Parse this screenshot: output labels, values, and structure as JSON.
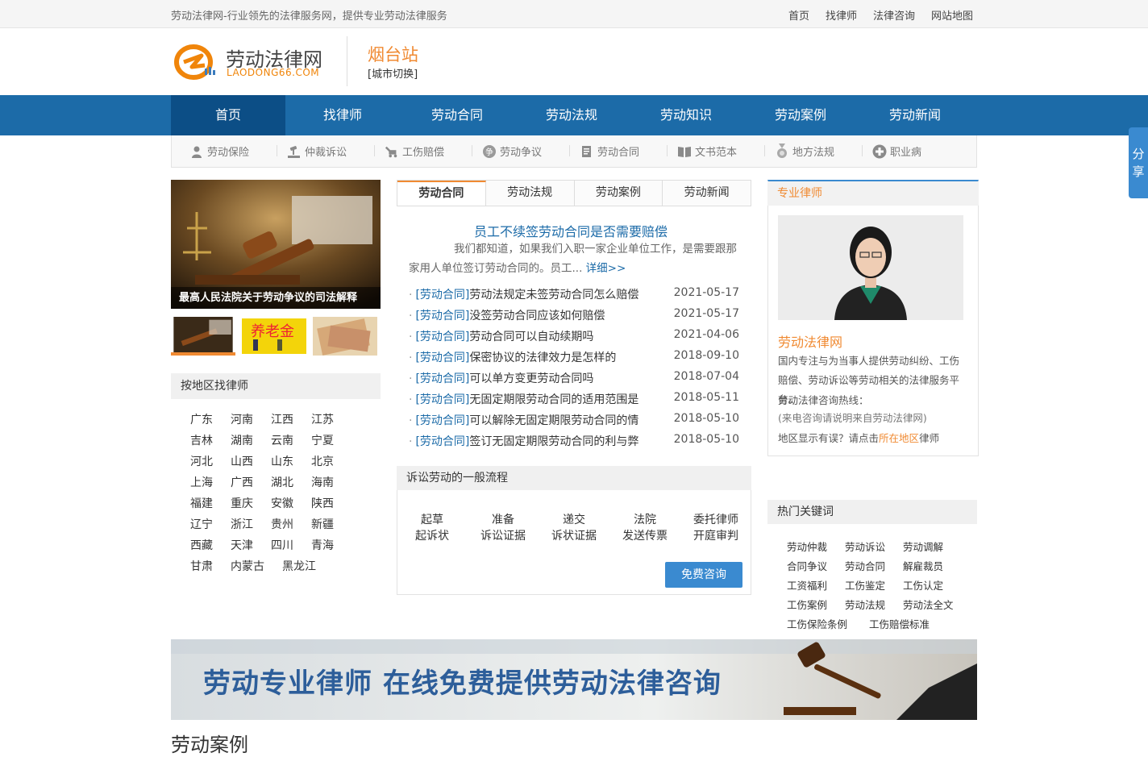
{
  "topbar": {
    "slogan": "劳动法律网-行业领先的法律服务网，提供专业劳动法律服务",
    "links": [
      "首页",
      "找律师",
      "法律咨询",
      "网站地图"
    ]
  },
  "header": {
    "logo_cn": "劳动法律网",
    "logo_en": "LAODONG66.COM",
    "city": "烟台站",
    "city_switch": "[城市切换]"
  },
  "nav": {
    "items": [
      "首页",
      "找律师",
      "劳动合同",
      "劳动法规",
      "劳动知识",
      "劳动案例",
      "劳动新闻"
    ]
  },
  "subnav": {
    "items": [
      {
        "label": "劳动保险",
        "icon": "person-icon"
      },
      {
        "label": "仲裁诉讼",
        "icon": "gavel-icon"
      },
      {
        "label": "工伤赔偿",
        "icon": "excavator-icon"
      },
      {
        "label": "劳动争议",
        "icon": "dispute-icon"
      },
      {
        "label": "劳动合同",
        "icon": "contract-icon"
      },
      {
        "label": "文书范本",
        "icon": "book-icon"
      },
      {
        "label": "地方法规",
        "icon": "medal-icon"
      },
      {
        "label": "职业病",
        "icon": "plus-circle-icon"
      }
    ]
  },
  "banner": {
    "caption": "最高人民法院关于劳动争议的司法解释",
    "thumb2_text": "养老金"
  },
  "region": {
    "title": "按地区找律师",
    "items": [
      "广东",
      "河南",
      "江西",
      "江苏",
      "吉林",
      "湖南",
      "云南",
      "宁夏",
      "河北",
      "山西",
      "山东",
      "北京",
      "上海",
      "广西",
      "湖北",
      "海南",
      "福建",
      "重庆",
      "安徽",
      "陕西",
      "辽宁",
      "浙江",
      "贵州",
      "新疆",
      "西藏",
      "天津",
      "四川",
      "青海",
      "甘肃",
      "内蒙古",
      "黑龙江"
    ]
  },
  "tabs": [
    "劳动合同",
    "劳动法规",
    "劳动案例",
    "劳动新闻"
  ],
  "featured": {
    "title": "员工不续签劳动合同是否需要赔偿",
    "summary": "我们都知道，如果我们入职一家企业单位工作，是需要跟那家用人单位签订劳动合同的。员工...",
    "more": "详细>>"
  },
  "news": [
    {
      "cat": "[劳动合同]",
      "title": "劳动法规定未签劳动合同怎么赔偿",
      "date": "2021-05-17"
    },
    {
      "cat": "[劳动合同]",
      "title": "没签劳动合同应该如何赔偿",
      "date": "2021-05-17"
    },
    {
      "cat": "[劳动合同]",
      "title": "劳动合同可以自动续期吗",
      "date": "2021-04-06"
    },
    {
      "cat": "[劳动合同]",
      "title": "保密协议的法律效力是怎样的",
      "date": "2018-09-10"
    },
    {
      "cat": "[劳动合同]",
      "title": "可以单方变更劳动合同吗",
      "date": "2018-07-04"
    },
    {
      "cat": "[劳动合同]",
      "title": "无固定期限劳动合同的适用范围是",
      "date": "2018-05-11"
    },
    {
      "cat": "[劳动合同]",
      "title": "可以解除无固定期限劳动合同的情",
      "date": "2018-05-10"
    },
    {
      "cat": "[劳动合同]",
      "title": "签订无固定期限劳动合同的利与弊",
      "date": "2018-05-10"
    }
  ],
  "process": {
    "title": "诉讼劳动的一般流程",
    "steps": [
      {
        "l1": "起草",
        "l2": "起诉状"
      },
      {
        "l1": "准备",
        "l2": "诉讼证据"
      },
      {
        "l1": "递交",
        "l2": "诉状证据"
      },
      {
        "l1": "法院",
        "l2": "发送传票"
      },
      {
        "l1": "委托律师",
        "l2": "开庭审判"
      }
    ],
    "button": "免费咨询"
  },
  "lawyer": {
    "title": "专业律师",
    "name": "劳动法律网",
    "desc": "国内专注与为当事人提供劳动纠纷、工伤赔偿、劳动诉讼等劳动相关的法律服务平台。",
    "hotline": "劳动法律咨询热线：",
    "note": "(来电咨询请说明来自劳动法律网)",
    "region_pre": "地区显示有误？请点击",
    "region_link": "所在地区",
    "region_post": "律师"
  },
  "keywords": {
    "title": "热门关键词",
    "items": [
      "劳动仲裁",
      "劳动诉讼",
      "劳动调解",
      "合同争议",
      "劳动合同",
      "解雇裁员",
      "工资福利",
      "工伤鉴定",
      "工伤认定",
      "工伤案例",
      "劳动法规",
      "劳动法全文",
      "工伤保险条例",
      "工伤赔偿标准"
    ]
  },
  "ad": {
    "text": "劳动专业律师  在线免费提供劳动法律咨询"
  },
  "section": {
    "title": "劳动案例"
  },
  "share": {
    "label": "分享"
  }
}
